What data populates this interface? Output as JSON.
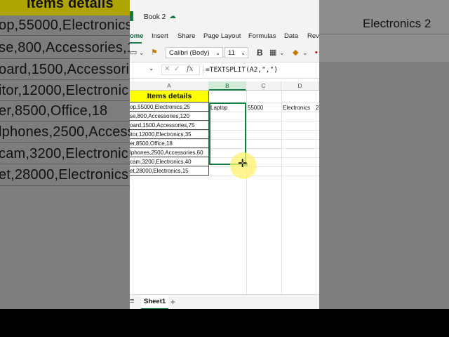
{
  "background": {
    "left_rows": [
      "Items details",
      "op,55000,Electronics",
      "se,800,Accessories,1",
      "oard,1500,Accessorie",
      "itor,12000,Electronic",
      "er,8500,Office,18",
      "lphones,2500,Access",
      "cam,3200,Electronic",
      "et,28000,Electronics,"
    ],
    "right_text": "Electronics   2"
  },
  "window": {
    "title": "Book 2",
    "ribbon_tabs": [
      "ome",
      "Insert",
      "Share",
      "Page Layout",
      "Formulas",
      "Data",
      "Revi"
    ],
    "font_name": "Calibri (Body)",
    "font_size": "11",
    "name_box": "",
    "fx_label": "fx",
    "formula": "=TEXTSPLIT(A2,\",\")"
  },
  "grid": {
    "columns": [
      "A",
      "B",
      "C",
      "D"
    ],
    "header_cell": "Items details",
    "col_a_rows": [
      "op,55000,Electronics,25",
      "se,800,Accessories,120",
      "oard,1500,Accessories,75",
      "itor,12000,Electronics,35",
      "er,8500,Office,18",
      "lphones,2500,Accessories,60",
      "cam,3200,Electronics,40",
      "et,28000,Electronics,15"
    ],
    "row2": {
      "b": "Laptop",
      "c": "55000",
      "d": "Electronics",
      "e": "2"
    }
  },
  "sheets": {
    "active": "Sheet1",
    "add_label": "+"
  },
  "colors": {
    "accent": "#107c41",
    "header_fill": "#ffff00"
  }
}
